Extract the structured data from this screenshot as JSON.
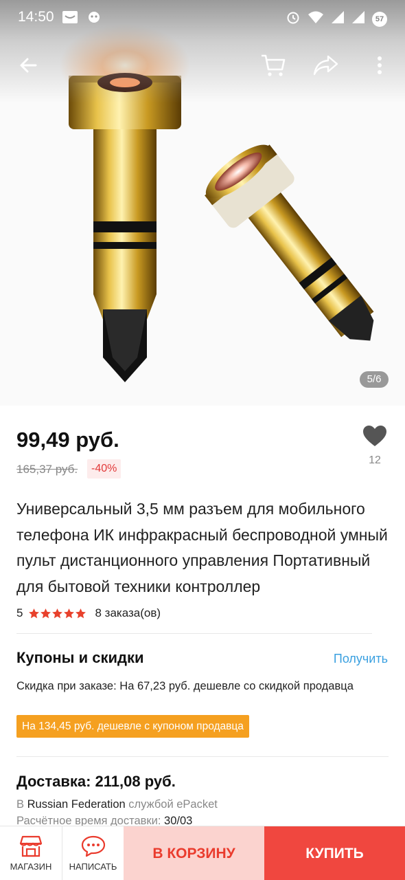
{
  "status_bar": {
    "time": "14:50",
    "battery": "57"
  },
  "toolbar": {
    "icons": [
      "back-arrow-icon",
      "cart-icon",
      "share-icon",
      "more-vert-icon"
    ]
  },
  "gallery": {
    "counter": "5/6"
  },
  "product": {
    "price": "99,49 руб.",
    "old_price": "165,37 руб.",
    "discount": "-40%",
    "wishlist_count": "12",
    "title": "Универсальный 3,5 мм разъем для мобильного телефона ИК инфракрасный беспроводной умный пульт дистанционного управления Портативный для бытовой техники контроллер",
    "rating": "5",
    "star_count": 5,
    "orders": "8 заказа(ов)"
  },
  "coupons": {
    "title": "Купоны и скидки",
    "get_label": "Получить",
    "discount_text": "Скидка при заказе: На 67,23 руб. дешевле со скидкой продавца",
    "coupon_tag": "На 134,45 руб. дешевле с купоном продавца"
  },
  "delivery": {
    "title": "Доставка: 211,08 руб.",
    "prefix": "В",
    "country": "Russian Federation",
    "service": "службой ePacket",
    "eta_label": "Расчётное время доставки:",
    "eta_value": "30/03"
  },
  "bottom_bar": {
    "store_label": "МАГАЗИН",
    "message_label": "НАПИСАТЬ",
    "cart_label": "В КОРЗИНУ",
    "buy_label": "КУПИТЬ"
  },
  "colors": {
    "accent_red": "#f0473f",
    "cart_bg": "#fbd3cf",
    "coupon_orange": "#f5a020",
    "link_blue": "#3aa0e0",
    "star_red": "#e8412c"
  }
}
